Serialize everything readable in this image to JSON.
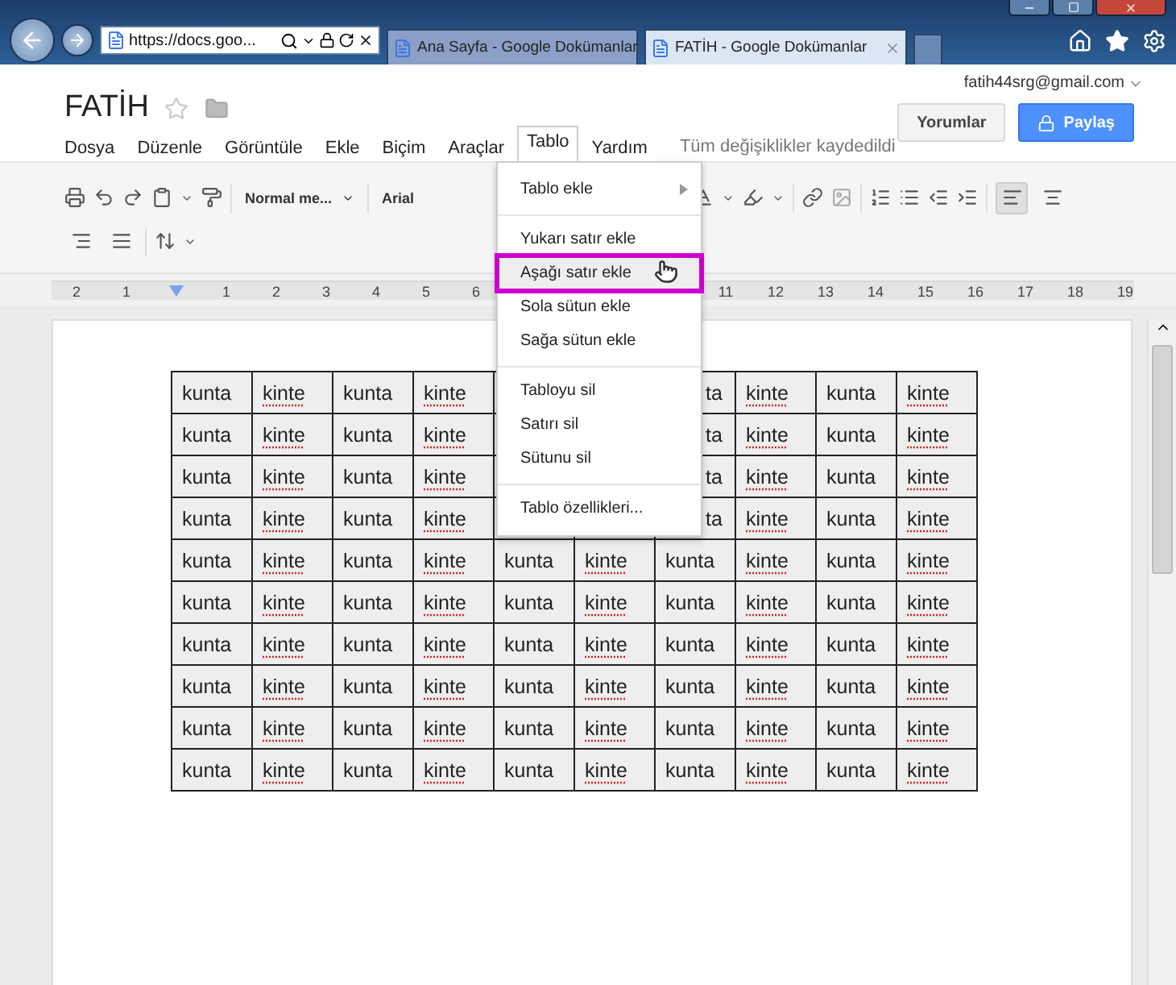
{
  "browser": {
    "address": "https://docs.goo...",
    "tabs": [
      {
        "title": "Ana Sayfa - Google Dokümanlar",
        "selected": false
      },
      {
        "title": "FATİH - Google Dokümanlar",
        "selected": true
      }
    ]
  },
  "document": {
    "title": "FATİH",
    "starred": false,
    "status": "Tüm değişiklikler kaydedildi"
  },
  "account": "fatih44srg@gmail.com",
  "buttons": [
    {
      "label": "Yorumlar",
      "kind": "secondary"
    },
    {
      "label": "Paylaş",
      "kind": "primary"
    }
  ],
  "menubar": [
    {
      "label": "Dosya",
      "selected": false
    },
    {
      "label": "Düzenle",
      "selected": false
    },
    {
      "label": "Görüntüle",
      "selected": false
    },
    {
      "label": "Ekle",
      "selected": false
    },
    {
      "label": "Biçim",
      "selected": false
    },
    {
      "label": "Araçlar",
      "selected": false
    },
    {
      "label": "Tablo",
      "selected": true
    },
    {
      "label": "Yardım",
      "selected": false
    }
  ],
  "toolbar": {
    "style": "Normal me...",
    "font": "Arial",
    "align_buttons": [
      {
        "selected": true
      },
      {
        "selected": false
      },
      {
        "selected": false
      },
      {
        "selected": false
      }
    ]
  },
  "ruler": {
    "before_indent": [
      "2",
      "1"
    ],
    "after_indent": [
      "1",
      "2",
      "3",
      "4",
      "5",
      "6"
    ],
    "after_menu": [
      "11",
      "12",
      "13",
      "14",
      "15",
      "16",
      "17",
      "18",
      "19"
    ]
  },
  "table": {
    "rows": [
      [
        {
          "t": "kunta",
          "misspelled": false
        },
        {
          "t": "kinte",
          "misspelled": true
        },
        {
          "t": "kunta",
          "misspelled": false
        },
        {
          "t": "kinte",
          "misspelled": true
        },
        null,
        null,
        {
          "t": "ta",
          "misspelled": false,
          "kind": "partial"
        },
        {
          "t": "kinte",
          "misspelled": true
        },
        {
          "t": "kunta",
          "misspelled": false
        },
        {
          "t": "kinte",
          "misspelled": true
        }
      ],
      [
        {
          "t": "kunta",
          "misspelled": false
        },
        {
          "t": "kinte",
          "misspelled": true
        },
        {
          "t": "kunta",
          "misspelled": false
        },
        {
          "t": "kinte",
          "misspelled": true
        },
        null,
        null,
        {
          "t": "ta",
          "misspelled": false,
          "kind": "partial"
        },
        {
          "t": "kinte",
          "misspelled": true
        },
        {
          "t": "kunta",
          "misspelled": false
        },
        {
          "t": "kinte",
          "misspelled": true
        }
      ],
      [
        {
          "t": "kunta",
          "misspelled": false
        },
        {
          "t": "kinte",
          "misspelled": true
        },
        {
          "t": "kunta",
          "misspelled": false
        },
        {
          "t": "kinte",
          "misspelled": true
        },
        null,
        null,
        {
          "t": "ta",
          "misspelled": false,
          "kind": "partial"
        },
        {
          "t": "kinte",
          "misspelled": true
        },
        {
          "t": "kunta",
          "misspelled": false
        },
        {
          "t": "kinte",
          "misspelled": true
        }
      ],
      [
        {
          "t": "kunta",
          "misspelled": false
        },
        {
          "t": "kinte",
          "misspelled": true
        },
        {
          "t": "kunta",
          "misspelled": false
        },
        {
          "t": "kinte",
          "misspelled": true
        },
        null,
        null,
        {
          "t": "ta",
          "misspelled": false,
          "kind": "partial"
        },
        {
          "t": "kinte",
          "misspelled": true
        },
        {
          "t": "kunta",
          "misspelled": false
        },
        {
          "t": "kinte",
          "misspelled": true
        }
      ],
      [
        {
          "t": "kunta",
          "misspelled": false
        },
        {
          "t": "kinte",
          "misspelled": true
        },
        {
          "t": "kunta",
          "misspelled": false
        },
        {
          "t": "kinte",
          "misspelled": true
        },
        {
          "t": "kunta",
          "misspelled": false
        },
        {
          "t": "kinte",
          "misspelled": true
        },
        {
          "t": "kunta",
          "misspelled": false
        },
        {
          "t": "kinte",
          "misspelled": true
        },
        {
          "t": "kunta",
          "misspelled": false
        },
        {
          "t": "kinte",
          "misspelled": true
        }
      ],
      [
        {
          "t": "kunta",
          "misspelled": false
        },
        {
          "t": "kinte",
          "misspelled": true
        },
        {
          "t": "kunta",
          "misspelled": false
        },
        {
          "t": "kinte",
          "misspelled": true
        },
        {
          "t": "kunta",
          "misspelled": false
        },
        {
          "t": "kinte",
          "misspelled": true
        },
        {
          "t": "kunta",
          "misspelled": false
        },
        {
          "t": "kinte",
          "misspelled": true
        },
        {
          "t": "kunta",
          "misspelled": false
        },
        {
          "t": "kinte",
          "misspelled": true
        }
      ],
      [
        {
          "t": "kunta",
          "misspelled": false
        },
        {
          "t": "kinte",
          "misspelled": true
        },
        {
          "t": "kunta",
          "misspelled": false
        },
        {
          "t": "kinte",
          "misspelled": true
        },
        {
          "t": "kunta",
          "misspelled": false
        },
        {
          "t": "kinte",
          "misspelled": true
        },
        {
          "t": "kunta",
          "misspelled": false
        },
        {
          "t": "kinte",
          "misspelled": true
        },
        {
          "t": "kunta",
          "misspelled": false
        },
        {
          "t": "kinte",
          "misspelled": true
        }
      ],
      [
        {
          "t": "kunta",
          "misspelled": false
        },
        {
          "t": "kinte",
          "misspelled": true
        },
        {
          "t": "kunta",
          "misspelled": false
        },
        {
          "t": "kinte",
          "misspelled": true
        },
        {
          "t": "kunta",
          "misspelled": false
        },
        {
          "t": "kinte",
          "misspelled": true
        },
        {
          "t": "kunta",
          "misspelled": false
        },
        {
          "t": "kinte",
          "misspelled": true
        },
        {
          "t": "kunta",
          "misspelled": false
        },
        {
          "t": "kinte",
          "misspelled": true
        }
      ],
      [
        {
          "t": "kunta",
          "misspelled": false
        },
        {
          "t": "kinte",
          "misspelled": true
        },
        {
          "t": "kunta",
          "misspelled": false
        },
        {
          "t": "kinte",
          "misspelled": true
        },
        {
          "t": "kunta",
          "misspelled": false
        },
        {
          "t": "kinte",
          "misspelled": true
        },
        {
          "t": "kunta",
          "misspelled": false
        },
        {
          "t": "kinte",
          "misspelled": true
        },
        {
          "t": "kunta",
          "misspelled": false
        },
        {
          "t": "kinte",
          "misspelled": true
        }
      ],
      [
        {
          "t": "kunta",
          "misspelled": false
        },
        {
          "t": "kinte",
          "misspelled": true
        },
        {
          "t": "kunta",
          "misspelled": false
        },
        {
          "t": "kinte",
          "misspelled": true
        },
        {
          "t": "kunta",
          "misspelled": false
        },
        {
          "t": "kinte",
          "misspelled": true
        },
        {
          "t": "kunta",
          "misspelled": false
        },
        {
          "t": "kinte",
          "misspelled": true
        },
        {
          "t": "kunta",
          "misspelled": false
        },
        {
          "t": "kinte",
          "misspelled": true
        }
      ]
    ]
  },
  "table_menu": {
    "items": [
      {
        "kind": "item",
        "label": "Tablo ekle",
        "submenu": true,
        "highlighted": false
      },
      {
        "kind": "separator"
      },
      {
        "kind": "item",
        "label": "Yukarı satır ekle",
        "submenu": false,
        "highlighted": false
      },
      {
        "kind": "item",
        "label": "Aşağı satır ekle",
        "submenu": false,
        "highlighted": true
      },
      {
        "kind": "item",
        "label": "Sola sütun ekle",
        "submenu": false,
        "highlighted": false
      },
      {
        "kind": "item",
        "label": "Sağa sütun ekle",
        "submenu": false,
        "highlighted": false
      },
      {
        "kind": "separator"
      },
      {
        "kind": "item",
        "label": "Tabloyu sil",
        "submenu": false,
        "highlighted": false
      },
      {
        "kind": "item",
        "label": "Satırı sil",
        "submenu": false,
        "highlighted": false
      },
      {
        "kind": "item",
        "label": "Sütunu sil",
        "submenu": false,
        "highlighted": false
      },
      {
        "kind": "separator"
      },
      {
        "kind": "item",
        "label": "Tablo özellikleri...",
        "submenu": false,
        "highlighted": false
      }
    ]
  }
}
